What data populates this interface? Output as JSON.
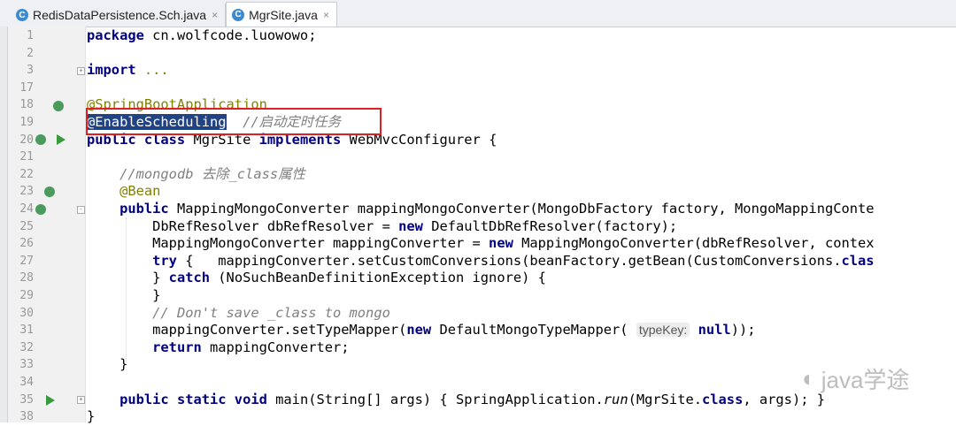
{
  "tabs": [
    {
      "label": "RedisDataPersistence.Sch.java",
      "close": "×",
      "icon": "C",
      "active": false
    },
    {
      "label": "MgrSite.java",
      "close": "×",
      "icon": "C",
      "active": true
    }
  ],
  "watermark": "java学途",
  "lines": [
    {
      "n": "1",
      "tokens": [
        {
          "t": "package",
          "c": "kw"
        },
        {
          "t": " cn.wolfcode.luowowo;",
          "c": ""
        }
      ]
    },
    {
      "n": "2",
      "tokens": []
    },
    {
      "n": "3",
      "tokens": [
        {
          "t": "import",
          "c": "kw"
        },
        {
          "t": " ...",
          "c": "ann"
        }
      ]
    },
    {
      "n": "17",
      "tokens": []
    },
    {
      "n": "18",
      "tokens": [
        {
          "t": "@SpringBootApplication",
          "c": "ann"
        }
      ]
    },
    {
      "n": "19",
      "tokens": [
        {
          "t": "@EnableScheduling",
          "c": "sel"
        },
        {
          "t": "  ",
          "c": ""
        },
        {
          "t": "//启动定时任务",
          "c": "cm"
        }
      ]
    },
    {
      "n": "20",
      "tokens": [
        {
          "t": "public class",
          "c": "kw"
        },
        {
          "t": " MgrSite ",
          "c": ""
        },
        {
          "t": "implements",
          "c": "kw"
        },
        {
          "t": " WebMvcConfigurer {",
          "c": ""
        }
      ]
    },
    {
      "n": "21",
      "tokens": []
    },
    {
      "n": "22",
      "tokens": [
        {
          "t": "    ",
          "c": ""
        },
        {
          "t": "//mongodb 去除_class属性",
          "c": "cm"
        }
      ]
    },
    {
      "n": "23",
      "tokens": [
        {
          "t": "    ",
          "c": ""
        },
        {
          "t": "@Bean",
          "c": "ann"
        }
      ]
    },
    {
      "n": "24",
      "tokens": [
        {
          "t": "    ",
          "c": ""
        },
        {
          "t": "public",
          "c": "kw"
        },
        {
          "t": " MappingMongoConverter mappingMongoConverter(MongoDbFactory factory, MongoMappingConte",
          "c": ""
        }
      ]
    },
    {
      "n": "25",
      "tokens": [
        {
          "t": "        DbRefResolver dbRefResolver = ",
          "c": ""
        },
        {
          "t": "new",
          "c": "kw"
        },
        {
          "t": " DefaultDbRefResolver(factory);",
          "c": ""
        }
      ]
    },
    {
      "n": "26",
      "tokens": [
        {
          "t": "        MappingMongoConverter mappingConverter = ",
          "c": ""
        },
        {
          "t": "new",
          "c": "kw"
        },
        {
          "t": " MappingMongoConverter(dbRefResolver, contex",
          "c": ""
        }
      ]
    },
    {
      "n": "27",
      "tokens": [
        {
          "t": "        ",
          "c": ""
        },
        {
          "t": "try",
          "c": "kw"
        },
        {
          "t": " {   mappingConverter.setCustomConversions(beanFactory.getBean(CustomConversions.",
          "c": ""
        },
        {
          "t": "clas",
          "c": "kw"
        }
      ]
    },
    {
      "n": "28",
      "tokens": [
        {
          "t": "        } ",
          "c": ""
        },
        {
          "t": "catch",
          "c": "kw"
        },
        {
          "t": " (NoSuchBeanDefinitionException ignore) {",
          "c": ""
        }
      ]
    },
    {
      "n": "29",
      "tokens": [
        {
          "t": "        }",
          "c": ""
        }
      ]
    },
    {
      "n": "30",
      "tokens": [
        {
          "t": "        ",
          "c": ""
        },
        {
          "t": "// Don't save _class to mongo",
          "c": "cm"
        }
      ]
    },
    {
      "n": "31",
      "tokens": [
        {
          "t": "        mappingConverter.setTypeMapper(",
          "c": ""
        },
        {
          "t": "new",
          "c": "kw"
        },
        {
          "t": " DefaultMongoTypeMapper( ",
          "c": ""
        },
        {
          "t": "typeKey:",
          "c": "hint"
        },
        {
          "t": " ",
          "c": ""
        },
        {
          "t": "null",
          "c": "kw"
        },
        {
          "t": "));",
          "c": ""
        }
      ]
    },
    {
      "n": "32",
      "tokens": [
        {
          "t": "        ",
          "c": ""
        },
        {
          "t": "return",
          "c": "kw"
        },
        {
          "t": " mappingConverter;",
          "c": ""
        }
      ]
    },
    {
      "n": "33",
      "tokens": [
        {
          "t": "    }",
          "c": ""
        }
      ]
    },
    {
      "n": "34",
      "tokens": []
    },
    {
      "n": "35",
      "tokens": [
        {
          "t": "    ",
          "c": ""
        },
        {
          "t": "public static void",
          "c": "kw"
        },
        {
          "t": " main(String[] args) { SpringApplication.",
          "c": ""
        },
        {
          "t": "run",
          "c": "static"
        },
        {
          "t": "(MgrSite.",
          "c": ""
        },
        {
          "t": "class",
          "c": "kw"
        },
        {
          "t": ", args); }",
          "c": ""
        }
      ]
    },
    {
      "n": "38",
      "tokens": [
        {
          "t": "}",
          "c": ""
        }
      ]
    }
  ]
}
